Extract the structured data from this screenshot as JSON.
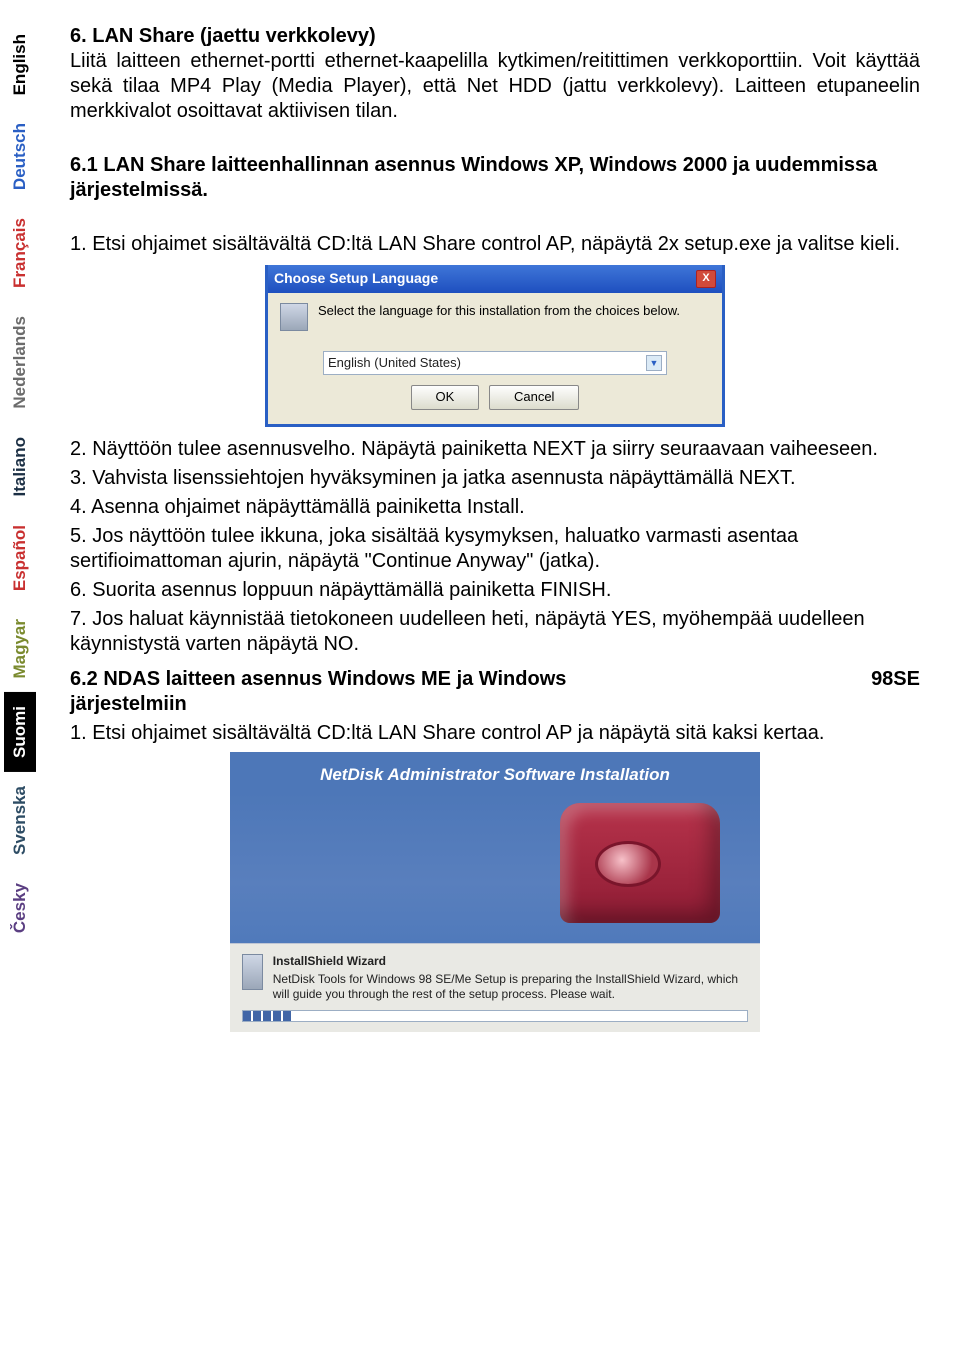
{
  "sidebar": {
    "items": [
      {
        "label": "English",
        "cls": "lang-black"
      },
      {
        "label": "Deutsch",
        "cls": "lang-blue"
      },
      {
        "label": "Français",
        "cls": "lang-red"
      },
      {
        "label": "Nederlands",
        "cls": "lang-gray1"
      },
      {
        "label": "Italiano",
        "cls": "lang-dark"
      },
      {
        "label": "Español",
        "cls": "lang-red"
      },
      {
        "label": "Magyar",
        "cls": "lang-olive"
      },
      {
        "label": "Suomi",
        "cls": "lang-suomi"
      },
      {
        "label": "Svenska",
        "cls": "lang-teal"
      },
      {
        "label": "Česky",
        "cls": "lang-purple"
      }
    ]
  },
  "section6": {
    "heading": "6. LAN Share (jaettu verkkolevy)",
    "p1": "Liitä laitteen ethernet-portti ethernet-kaapelilla kytkimen/reitittimen verkkoporttiin. Voit käyttää sekä tilaa MP4 Play (Media Player), että Net HDD (jattu verkkolevy). Laitteen etupaneelin merkkivalot osoittavat aktiivisen tilan.",
    "sub61": "6.1 LAN Share laitteenhallinnan asennus Windows XP, Windows 2000 ja uudemmissa järjestelmissä.",
    "step1": "1. Etsi ohjaimet sisältävältä CD:ltä LAN Share control AP, näpäytä 2x setup.exe ja valitse kieli."
  },
  "dialog": {
    "title": "Choose Setup Language",
    "text": "Select the language for this installation from the choices below.",
    "option": "English (United States)",
    "ok": "OK",
    "cancel": "Cancel",
    "close": "X"
  },
  "steps": {
    "s2": "2. Näyttöön tulee asennusvelho. Näpäytä painiketta NEXT ja siirry seuraavaan vaiheeseen.",
    "s3": "3. Vahvista lisenssiehtojen hyväksyminen ja jatka asennusta näpäyttämällä NEXT.",
    "s4": "4. Asenna ohjaimet näpäyttämällä painiketta Install.",
    "s5": "5. Jos näyttöön tulee ikkuna, joka sisältää kysymyksen, haluatko varmasti asentaa sertifioimattoman ajurin, näpäytä \"Continue Anyway\" (jatka).",
    "s6": "6. Suorita asennus loppuun näpäyttämällä painiketta FINISH.",
    "s7": "7. Jos haluat käynnistää tietokoneen uudelleen heti, näpäytä YES, myöhempää uudelleen käynnistystä varten näpäytä NO."
  },
  "section62": {
    "line_a": "6.2    NDAS    laitteen    asennus    Windows    ME    ja    Windows",
    "line_a_end": "98SE",
    "line_b": "järjestelmiin",
    "step1": "1. Etsi ohjaimet sisältävältä CD:ltä LAN Share control AP ja näpäytä sitä kaksi kertaa."
  },
  "installer": {
    "title": "NetDisk Administrator Software Installation",
    "panel_head": "InstallShield Wizard",
    "panel_text": "NetDisk Tools for Windows 98 SE/Me Setup is preparing the InstallShield Wizard, which will guide you through the rest of the setup process. Please wait."
  }
}
